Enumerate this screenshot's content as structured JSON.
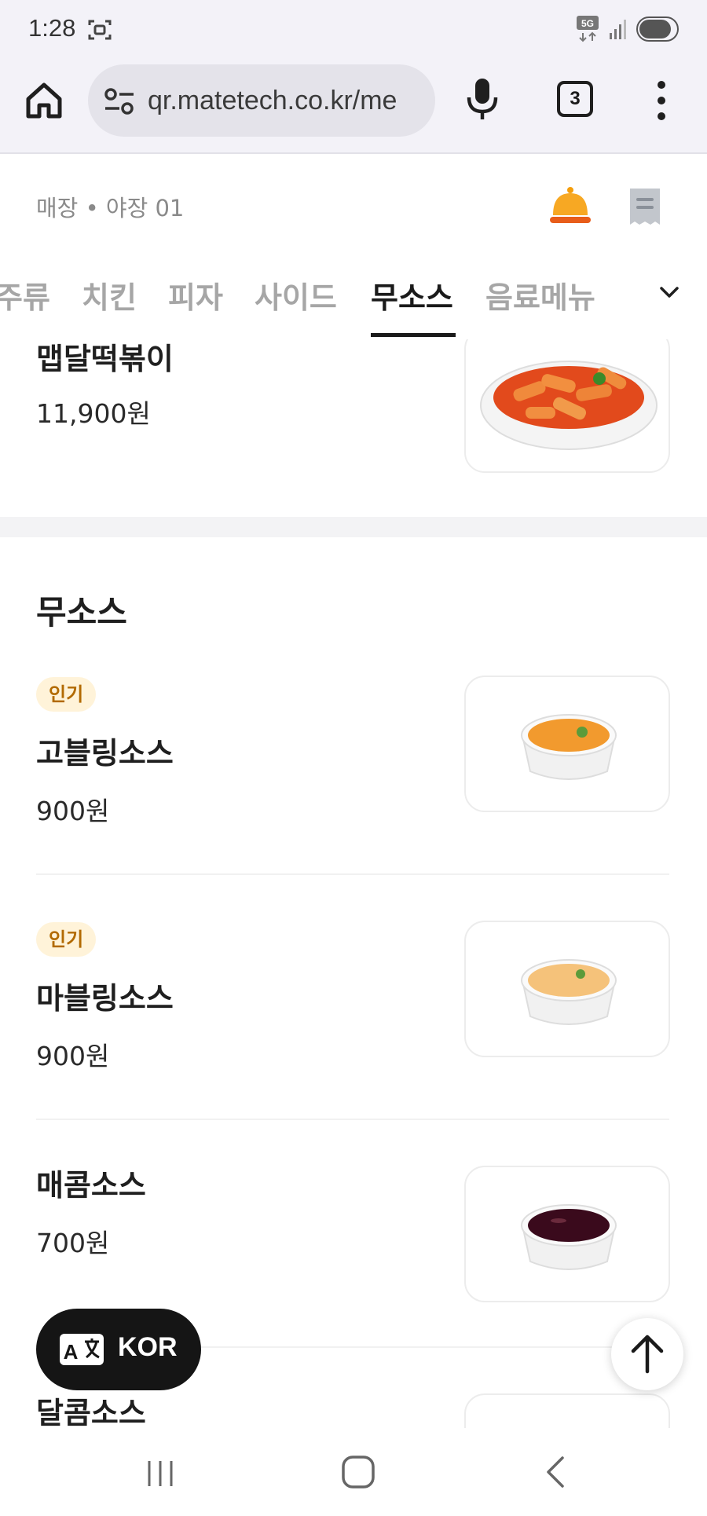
{
  "status_bar": {
    "time": "1:28",
    "network": "5G"
  },
  "browser": {
    "url": "qr.matetech.co.kr/me",
    "tab_count": "3"
  },
  "store": {
    "label": "매장 • 야장 01"
  },
  "categories": {
    "tabs": [
      {
        "label": "주류",
        "active": false
      },
      {
        "label": "치킨",
        "active": false
      },
      {
        "label": "피자",
        "active": false
      },
      {
        "label": "사이드",
        "active": false
      },
      {
        "label": "무소스",
        "active": true
      },
      {
        "label": "음료메뉴",
        "active": false
      }
    ]
  },
  "menu": {
    "previous_item": {
      "name": "맵달떡볶이",
      "price": "11,900원"
    },
    "section_title": "무소스",
    "items": [
      {
        "badge": "인기",
        "name": "고블링소스",
        "price": "900원",
        "image": "orange-sauce-cup"
      },
      {
        "badge": "인기",
        "name": "마블링소스",
        "price": "900원",
        "image": "cream-sauce-cup"
      },
      {
        "badge": "",
        "name": "매콤소스",
        "price": "700원",
        "image": "dark-red-sauce-cup"
      },
      {
        "badge": "",
        "name": "달콤소스",
        "price": "",
        "image": "sauce-cup"
      }
    ]
  },
  "floating": {
    "language": "KOR"
  },
  "icons": {
    "home": "home-icon",
    "site_settings": "tune-icon",
    "mic": "mic-icon",
    "more": "more-vert-icon",
    "bell": "service-bell-icon",
    "receipt": "receipt-icon",
    "chevron": "chevron-down-icon",
    "translate": "translate-icon",
    "scroll_top": "arrow-up-icon"
  },
  "colors": {
    "accent": "#f59e0b",
    "badge_bg": "#fff3d9",
    "badge_text": "#b26a00",
    "active_tab": "#1a1a1a"
  }
}
